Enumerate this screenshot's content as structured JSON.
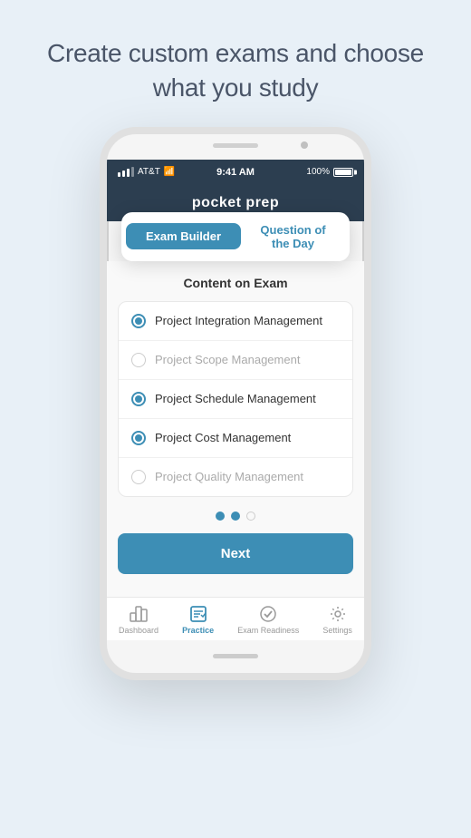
{
  "page": {
    "headline": "Create custom exams and choose what you study"
  },
  "header": {
    "app_name": "pocket prep"
  },
  "status_bar": {
    "carrier": "AT&T",
    "time": "9:41 AM",
    "battery": "100%"
  },
  "tabs": {
    "active": "Exam Builder",
    "inactive": "Question of the Day"
  },
  "content": {
    "title": "Content on Exam",
    "options": [
      {
        "label": "Project Integration Management",
        "selected": true
      },
      {
        "label": "Project Scope Management",
        "selected": false
      },
      {
        "label": "Project Schedule Management",
        "selected": true
      },
      {
        "label": "Project Cost Management",
        "selected": true
      },
      {
        "label": "Project Quality Management",
        "selected": false
      }
    ],
    "next_button": "Next"
  },
  "pagination": {
    "dots": 3,
    "active": [
      0,
      1
    ]
  },
  "bottom_nav": [
    {
      "id": "dashboard",
      "label": "Dashboard",
      "active": false
    },
    {
      "id": "practice",
      "label": "Practice",
      "active": true
    },
    {
      "id": "exam-readiness",
      "label": "Exam Readiness",
      "active": false
    },
    {
      "id": "settings",
      "label": "Settings",
      "active": false
    }
  ]
}
